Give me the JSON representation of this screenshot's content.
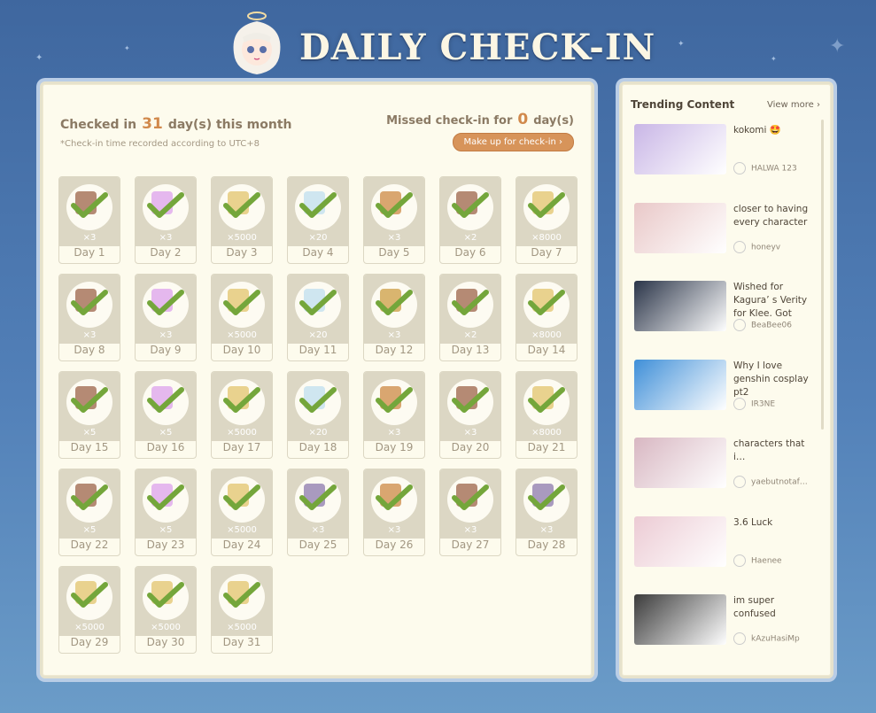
{
  "header": {
    "title": "DAILY CHECK-IN"
  },
  "summary": {
    "checked_prefix": "Checked in",
    "checked_count": "31",
    "checked_suffix": "day(s) this month",
    "note": "*Check-in time recorded according to UTC+8",
    "missed_prefix": "Missed check-in for",
    "missed_count": "0",
    "missed_suffix": "day(s)",
    "makeup_label": "Make up for check-in ›"
  },
  "days": [
    {
      "day": "Day 1",
      "count": "×3",
      "item": "mora-ore"
    },
    {
      "day": "Day 2",
      "count": "×3",
      "item": "crystal"
    },
    {
      "day": "Day 3",
      "count": "×5000",
      "item": "mora"
    },
    {
      "day": "Day 4",
      "count": "×20",
      "item": "primogem"
    },
    {
      "day": "Day 5",
      "count": "×3",
      "item": "food"
    },
    {
      "day": "Day 6",
      "count": "×2",
      "item": "mora-ore"
    },
    {
      "day": "Day 7",
      "count": "×8000",
      "item": "mora"
    },
    {
      "day": "Day 8",
      "count": "×3",
      "item": "mora-ore"
    },
    {
      "day": "Day 9",
      "count": "×3",
      "item": "crystal"
    },
    {
      "day": "Day 10",
      "count": "×5000",
      "item": "mora"
    },
    {
      "day": "Day 11",
      "count": "×20",
      "item": "primogem"
    },
    {
      "day": "Day 12",
      "count": "×3",
      "item": "skewer"
    },
    {
      "day": "Day 13",
      "count": "×2",
      "item": "mora-ore"
    },
    {
      "day": "Day 14",
      "count": "×8000",
      "item": "mora"
    },
    {
      "day": "Day 15",
      "count": "×5",
      "item": "mora-ore"
    },
    {
      "day": "Day 16",
      "count": "×5",
      "item": "crystal"
    },
    {
      "day": "Day 17",
      "count": "×5000",
      "item": "mora"
    },
    {
      "day": "Day 18",
      "count": "×20",
      "item": "primogem"
    },
    {
      "day": "Day 19",
      "count": "×3",
      "item": "food"
    },
    {
      "day": "Day 20",
      "count": "×3",
      "item": "mora-ore"
    },
    {
      "day": "Day 21",
      "count": "×8000",
      "item": "mora"
    },
    {
      "day": "Day 22",
      "count": "×5",
      "item": "mora-ore"
    },
    {
      "day": "Day 23",
      "count": "×5",
      "item": "crystal"
    },
    {
      "day": "Day 24",
      "count": "×5000",
      "item": "mora"
    },
    {
      "day": "Day 25",
      "count": "×3",
      "item": "book"
    },
    {
      "day": "Day 26",
      "count": "×3",
      "item": "food"
    },
    {
      "day": "Day 27",
      "count": "×3",
      "item": "mora-ore"
    },
    {
      "day": "Day 28",
      "count": "×3",
      "item": "book"
    },
    {
      "day": "Day 29",
      "count": "×5000",
      "item": "mora"
    },
    {
      "day": "Day 30",
      "count": "×5000",
      "item": "mora"
    },
    {
      "day": "Day 31",
      "count": "×5000",
      "item": "mora"
    }
  ],
  "sidebar": {
    "title": "Trending Content",
    "view_more": "View more ›",
    "items": [
      {
        "text": "kokomi 🤩",
        "user": "HALWA 123",
        "thumb": "#c9b6e6"
      },
      {
        "text": "closer to having every character",
        "user": "honeyv",
        "thumb": "#e9c8c8"
      },
      {
        "text": "Wished for Kagura’ s Verity for Klee. Got he…",
        "user": "BeaBee06",
        "thumb": "#2a3448"
      },
      {
        "text": "Why I love genshin cosplay pt2",
        "user": "IR3NE",
        "thumb": "#3f8fd8"
      },
      {
        "text": "characters that i…",
        "user": "yaebutnotaf…",
        "thumb": "#d8b7c2"
      },
      {
        "text": "3.6 Luck",
        "user": "Haenee",
        "thumb": "#eccbd4"
      },
      {
        "text": "im super confused",
        "user": "kAzuHasiMp",
        "thumb": "#3b3b3b"
      }
    ]
  },
  "colors": {
    "accent": "#d7945a",
    "check": "#74a63b",
    "tile": "#dcd7c4",
    "background": "#4e7db5"
  }
}
